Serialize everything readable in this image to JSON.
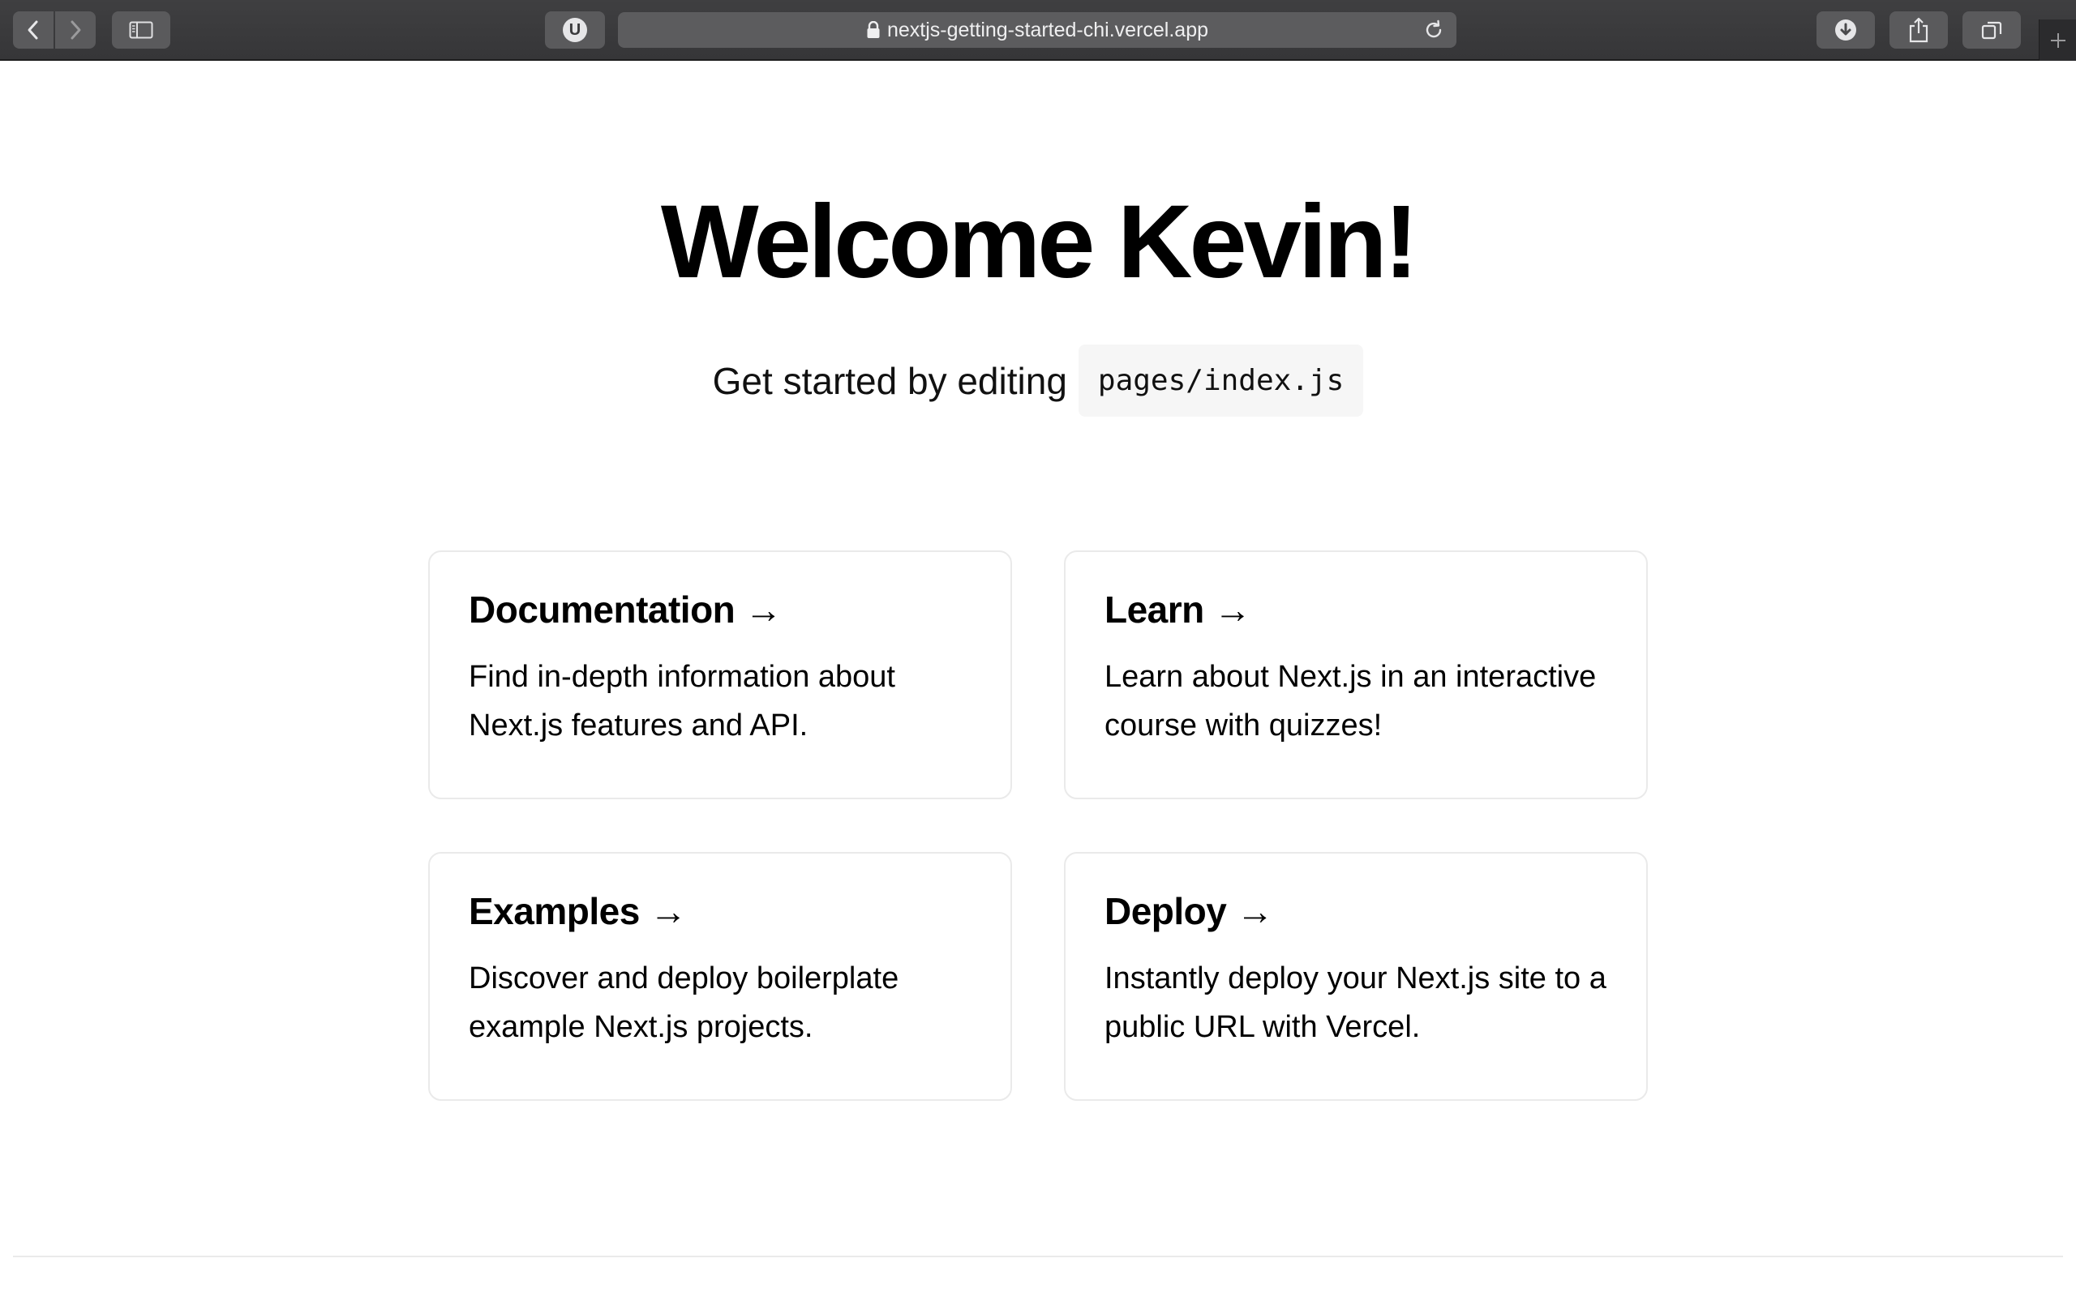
{
  "browser": {
    "url": "nextjs-getting-started-chi.vercel.app",
    "extension_badge": "U",
    "icons": {
      "back": "chevron-left-icon",
      "forward": "chevron-right-icon",
      "sidebar": "sidebar-icon",
      "lock": "lock-icon",
      "reload": "reload-icon",
      "downloads": "download-icon",
      "share": "share-icon",
      "tabs": "tabs-overview-icon",
      "new_tab": "plus-icon"
    }
  },
  "page": {
    "title": "Welcome Kevin!",
    "subtitle_text": "Get started by editing",
    "subtitle_code": "pages/index.js",
    "cards": [
      {
        "title": "Documentation →",
        "description": "Find in-depth information about Next.js features and API."
      },
      {
        "title": "Learn →",
        "description": "Learn about Next.js in an interactive course with quizzes!"
      },
      {
        "title": "Examples →",
        "description": "Discover and deploy boilerplate example Next.js projects."
      },
      {
        "title": "Deploy →",
        "description": "Instantly deploy your Next.js site to a public URL with Vercel."
      }
    ]
  },
  "colors": {
    "toolbar": "#3a3a3c",
    "card_border": "#eaeaea",
    "code_bg": "#f6f6f6"
  }
}
